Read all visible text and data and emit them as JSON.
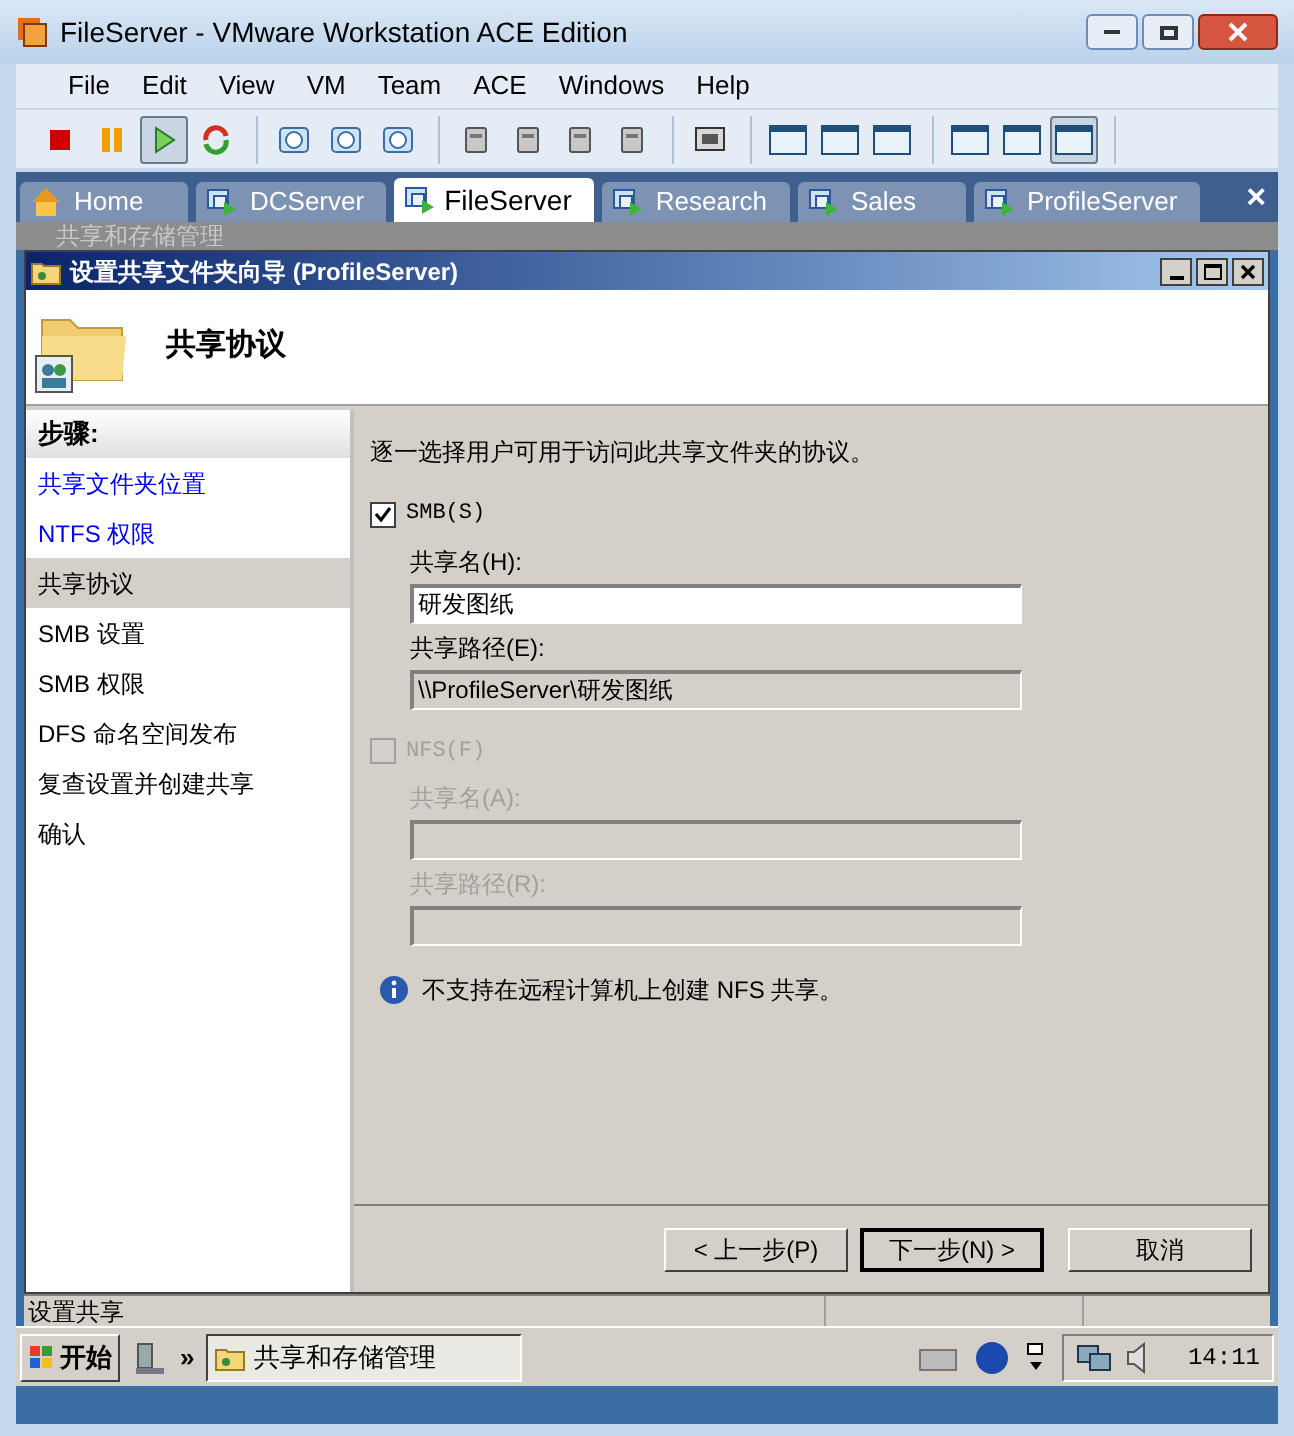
{
  "window": {
    "title": "FileServer - VMware Workstation ACE Edition"
  },
  "menu": [
    "File",
    "Edit",
    "View",
    "VM",
    "Team",
    "ACE",
    "Windows",
    "Help"
  ],
  "toolbar": [
    [
      {
        "kind": "stop",
        "pressed": false
      },
      {
        "kind": "pause",
        "pressed": false
      },
      {
        "kind": "play",
        "pressed": true
      },
      {
        "kind": "reset",
        "pressed": false
      }
    ],
    [
      {
        "kind": "clock",
        "pressed": false
      },
      {
        "kind": "clock",
        "pressed": false
      },
      {
        "kind": "clock",
        "pressed": false
      }
    ],
    [
      {
        "kind": "device",
        "pressed": false
      },
      {
        "kind": "device",
        "pressed": false
      },
      {
        "kind": "device",
        "pressed": false
      },
      {
        "kind": "device",
        "pressed": false
      }
    ],
    [
      {
        "kind": "screen",
        "pressed": false
      }
    ],
    [
      {
        "kind": "panel",
        "pressed": false
      },
      {
        "kind": "panel",
        "pressed": false
      },
      {
        "kind": "panel",
        "pressed": false
      }
    ],
    [
      {
        "kind": "panel",
        "pressed": false
      },
      {
        "kind": "panel",
        "pressed": false
      },
      {
        "kind": "panel",
        "pressed": true
      }
    ]
  ],
  "tabs": [
    {
      "label": "Home",
      "kind": "home",
      "selected": false
    },
    {
      "label": "DCServer",
      "kind": "vm",
      "selected": false
    },
    {
      "label": "FileServer",
      "kind": "vm",
      "selected": true
    },
    {
      "label": "Research",
      "kind": "vm",
      "selected": false
    },
    {
      "label": "Sales",
      "kind": "vm",
      "selected": false
    },
    {
      "label": "ProfileServer",
      "kind": "vm",
      "selected": false
    }
  ],
  "tab_close": "×",
  "behind_window": {
    "title": "共享和存储管理"
  },
  "wizard": {
    "title": "设置共享文件夹向导 (ProfileServer)",
    "header": "共享协议",
    "steps_heading": "步骤:",
    "steps": [
      {
        "label": "共享文件夹位置",
        "completed": true,
        "selected": false
      },
      {
        "label": "NTFS 权限",
        "completed": true,
        "selected": false
      },
      {
        "label": "共享协议",
        "completed": false,
        "selected": true
      },
      {
        "label": "SMB 设置",
        "completed": false,
        "selected": false
      },
      {
        "label": "SMB 权限",
        "completed": false,
        "selected": false
      },
      {
        "label": "DFS 命名空间发布",
        "completed": false,
        "selected": false
      },
      {
        "label": "复查设置并创建共享",
        "completed": false,
        "selected": false
      },
      {
        "label": "确认",
        "completed": false,
        "selected": false
      }
    ],
    "intro": "逐一选择用户可用于访问此共享文件夹的协议。",
    "protocols": [
      {
        "label": "SMB(S)",
        "checked": true,
        "disabled": false,
        "fields": [
          {
            "label": "共享名(H):",
            "value": "研发图纸",
            "readonly": false
          },
          {
            "label": "共享路径(E):",
            "value": "\\\\ProfileServer\\研发图纸",
            "readonly": true
          }
        ]
      },
      {
        "label": "NFS(F)",
        "checked": false,
        "disabled": true,
        "fields": [
          {
            "label": "共享名(A):"
          },
          {
            "label": "共享路径(R):"
          }
        ]
      }
    ],
    "note": "不支持在远程计算机上创建 NFS 共享。",
    "buttons": [
      {
        "label": "< 上一步(P)",
        "default": false
      },
      {
        "label": "下一步(N) >",
        "default": true
      },
      {
        "label": "取消",
        "default": false
      }
    ]
  },
  "status_bar": "设置共享",
  "taskbar": {
    "start": "开始",
    "chevron": "»",
    "task": "共享和存储管理",
    "clock": "14:11"
  }
}
